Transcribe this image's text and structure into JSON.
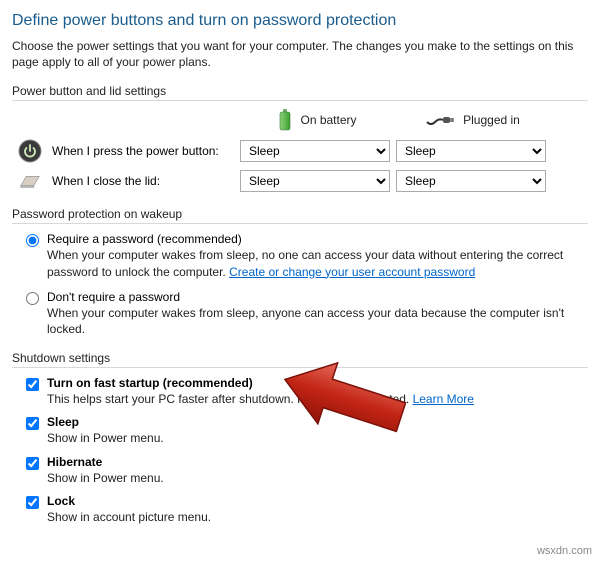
{
  "page": {
    "title": "Define power buttons and turn on password protection",
    "description": "Choose the power settings that you want for your computer. The changes you make to the settings on this page apply to all of your power plans."
  },
  "sections": {
    "power_button": "Power button and lid settings",
    "password": "Password protection on wakeup",
    "shutdown": "Shutdown settings"
  },
  "columns": {
    "battery": "On battery",
    "plugged": "Plugged in"
  },
  "rows": {
    "press_power": {
      "label": "When I press the power button:",
      "battery_value": "Sleep",
      "plugged_value": "Sleep"
    },
    "close_lid": {
      "label": "When I close the lid:",
      "battery_value": "Sleep",
      "plugged_value": "Sleep"
    }
  },
  "password_options": {
    "require": {
      "title": "Require a password (recommended)",
      "desc_a": "When your computer wakes from sleep, no one can access your data without entering the correct password to unlock the computer. ",
      "link": "Create or change your user account password"
    },
    "dont_require": {
      "title": "Don't require a password",
      "desc": "When your computer wakes from sleep, anyone can access your data because the computer isn't locked."
    }
  },
  "shutdown_options": {
    "fast_startup": {
      "title": "Turn on fast startup (recommended)",
      "desc_a": "This helps start your PC faster after shutdown. Restart isn't affected. ",
      "link": "Learn More"
    },
    "sleep": {
      "title": "Sleep",
      "desc": "Show in Power menu."
    },
    "hibernate": {
      "title": "Hibernate",
      "desc": "Show in Power menu."
    },
    "lock": {
      "title": "Lock",
      "desc": "Show in account picture menu."
    }
  },
  "watermark": "wsxdn.com"
}
